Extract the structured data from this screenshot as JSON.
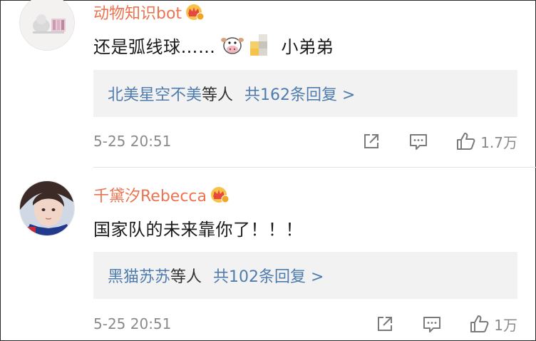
{
  "comments": [
    {
      "username": "动物知识bot",
      "text_before": "还是弧线球……",
      "text_after": "小弟弟",
      "reply_names": "北美星空不美",
      "reply_deng": "等人",
      "reply_suffix": "共162条回复 >",
      "time": "5-25 20:51",
      "likes": "1.7万",
      "icons": [
        "share-icon",
        "comment-icon",
        "like-icon"
      ]
    },
    {
      "username": "千黛汐Rebecca",
      "text": "国家队的未来靠你了！！！",
      "reply_names": "黑猫苏苏",
      "reply_deng": "等人",
      "reply_suffix": "共102条回复 >",
      "time": "5-25 20:51",
      "likes": "1万",
      "icons": [
        "share-icon",
        "comment-icon",
        "like-icon"
      ]
    }
  ],
  "colors": {
    "username": "#eb7350",
    "link": "#4f7cae",
    "meta": "#8a8a8a",
    "reply_bg": "#f2f2f2"
  }
}
